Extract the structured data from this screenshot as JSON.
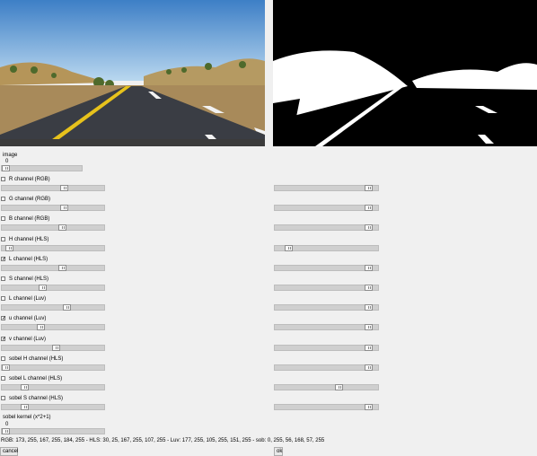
{
  "image": {
    "label": "image",
    "value": "0",
    "slider_pos": 0.0
  },
  "channels": [
    {
      "label": "R channel (RGB)",
      "checked": false,
      "min_pos": 0.62,
      "max_pos": 0.94
    },
    {
      "label": "G channel (RGB)",
      "checked": false,
      "min_pos": 0.62,
      "max_pos": 0.94
    },
    {
      "label": "B channel (RGB)",
      "checked": false,
      "min_pos": 0.6,
      "max_pos": 0.94
    },
    {
      "label": "H channel (HLS)",
      "checked": false,
      "min_pos": 0.04,
      "max_pos": 0.1
    },
    {
      "label": "L channel (HLS)",
      "checked": true,
      "min_pos": 0.6,
      "max_pos": 0.94
    },
    {
      "label": "S channel (HLS)",
      "checked": false,
      "min_pos": 0.39,
      "max_pos": 0.94
    },
    {
      "label": "L channel (Luv)",
      "checked": false,
      "min_pos": 0.65,
      "max_pos": 0.94
    },
    {
      "label": "u channel (Luv)",
      "checked": true,
      "min_pos": 0.37,
      "max_pos": 0.94
    },
    {
      "label": "v channel (Luv)",
      "checked": true,
      "min_pos": 0.53,
      "max_pos": 0.94
    },
    {
      "label": "sobel H channel (HLS)",
      "checked": false,
      "min_pos": 0.0,
      "max_pos": 0.94
    },
    {
      "label": "sobel L channel (HLS)",
      "checked": false,
      "min_pos": 0.2,
      "max_pos": 0.63
    },
    {
      "label": "sobel S channel (HLS)",
      "checked": false,
      "min_pos": 0.2,
      "max_pos": 0.94
    }
  ],
  "sobel_kernel": {
    "label": "sobel kernel (x*2+1)",
    "value": "0",
    "slider_pos": 0.0
  },
  "status_text": "RGB: 173, 255, 167, 255, 184, 255 - HLS: 30, 25, 167, 255, 107, 255 - Luv: 177, 255, 105, 255, 151, 255 - sob: 0, 255, 56, 168, 57, 255",
  "buttons": {
    "cancel": "cancel",
    "ok": "ok"
  }
}
